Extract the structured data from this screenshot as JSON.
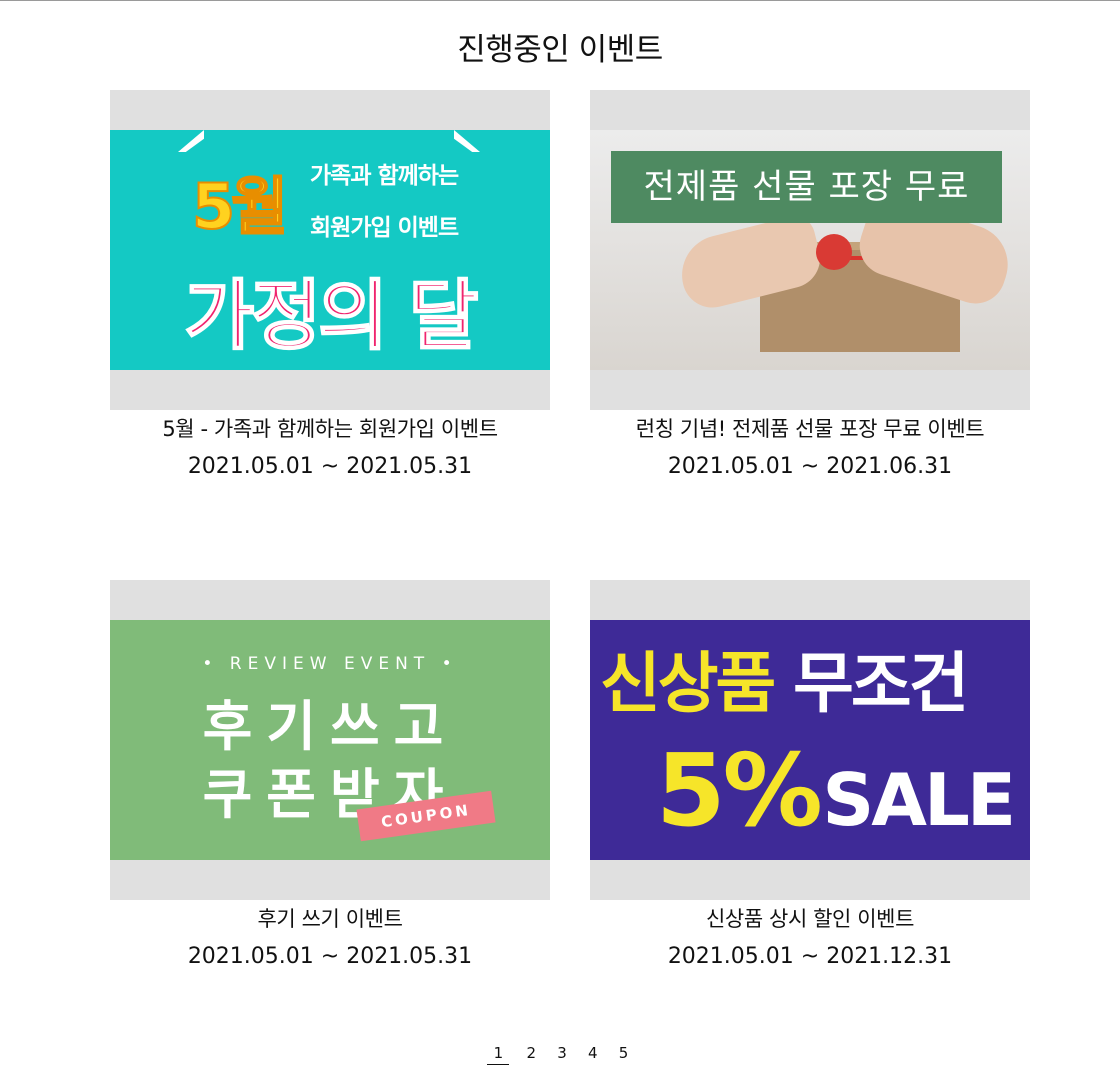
{
  "page": {
    "title": "진행중인 이벤트"
  },
  "events": [
    {
      "title": "5월 - 가족과 함께하는 회원가입 이벤트",
      "period": "2021.05.01 ~ 2021.05.31",
      "banner": {
        "big": "5월",
        "line1": "가족과 함께하는",
        "line2": "회원가입 이벤트",
        "headline": "가정의 달",
        "colors": {
          "background": "#14c9c4",
          "accent": "#f0246e",
          "highlight": "#ffd21f"
        }
      }
    },
    {
      "title": "런칭 기념! 전제품 선물 포장 무료 이벤트",
      "period": "2021.05.01 ~ 2021.06.31",
      "banner": {
        "label": "전제품 선물 포장 무료",
        "colors": {
          "label_bg": "#4e8a61"
        }
      }
    },
    {
      "title": "후기 쓰기 이벤트",
      "period": "2021.05.01 ~ 2021.05.31",
      "banner": {
        "sub": "• REVIEW EVENT •",
        "line1": "후기쓰고",
        "line2": "쿠폰받자",
        "tag": "COUPON",
        "colors": {
          "background": "#80bb79",
          "tag": "#f07a86"
        }
      }
    },
    {
      "title": "신상품 상시 할인 이벤트",
      "period": "2021.05.01 ~ 2021.12.31",
      "banner": {
        "line1_a": "신상품",
        "line1_b": "무조건",
        "pct": "5%",
        "sale": "SALE",
        "colors": {
          "background": "#3e2a97",
          "yellow": "#f6e529"
        }
      }
    }
  ],
  "pagination": {
    "pages": [
      "1",
      "2",
      "3",
      "4",
      "5"
    ],
    "current": "1"
  }
}
